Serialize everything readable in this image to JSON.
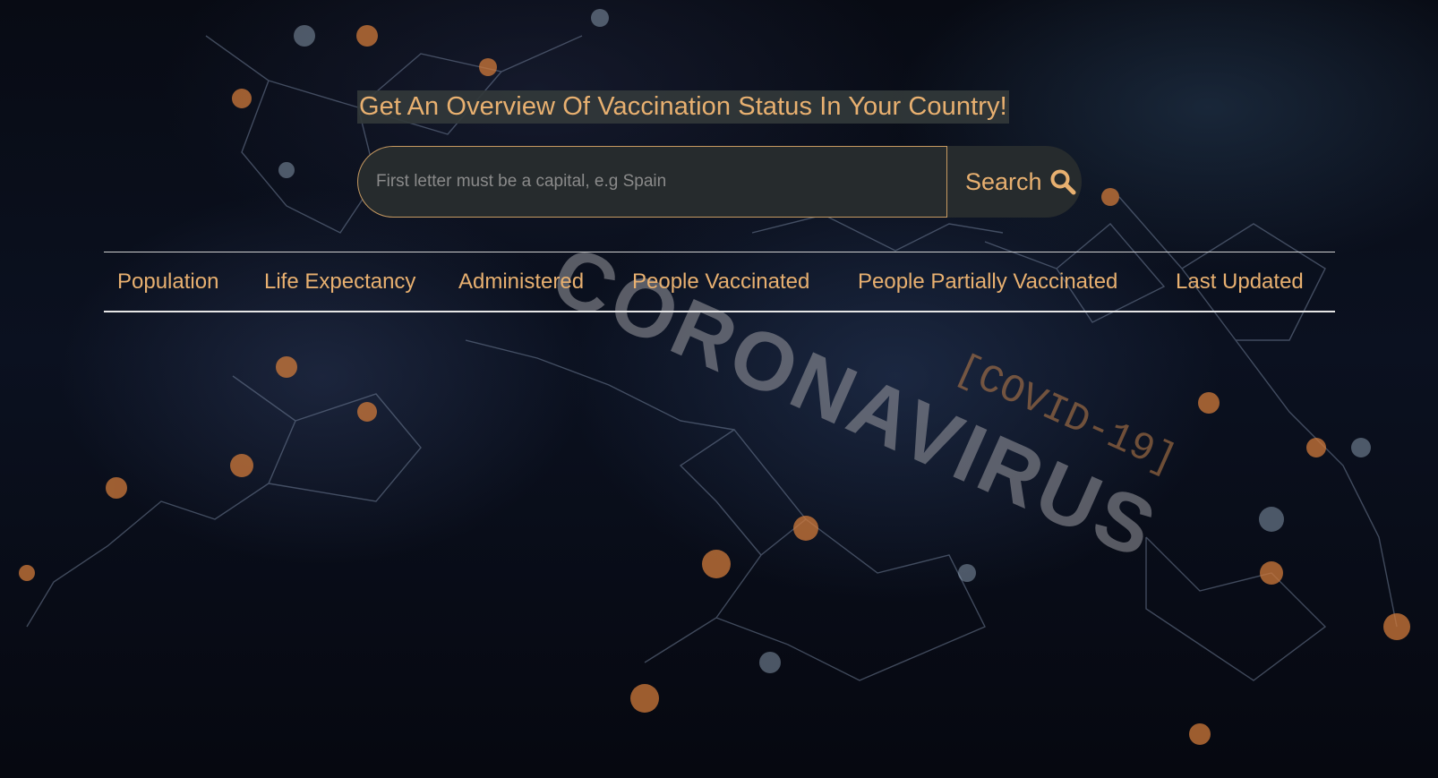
{
  "header": {
    "title": "Get An Overview Of Vaccination Status In Your Country!"
  },
  "search": {
    "placeholder": "First letter must be a capital, e.g Spain",
    "value": "",
    "button_label": "Search",
    "button_icon": "search-icon"
  },
  "table": {
    "columns": [
      "Population",
      "Life Expectancy",
      "Administered",
      "People Vaccinated",
      "People Partially Vaccinated",
      "Last Updated"
    ],
    "rows": []
  },
  "background": {
    "watermark_main": "CORONAVIRUS",
    "watermark_sub": "[COVID-19]"
  },
  "colors": {
    "accent": "#e8b070",
    "field_bg": "#262b2d",
    "border": "#c79a61",
    "rule": "#e6e6e6"
  }
}
